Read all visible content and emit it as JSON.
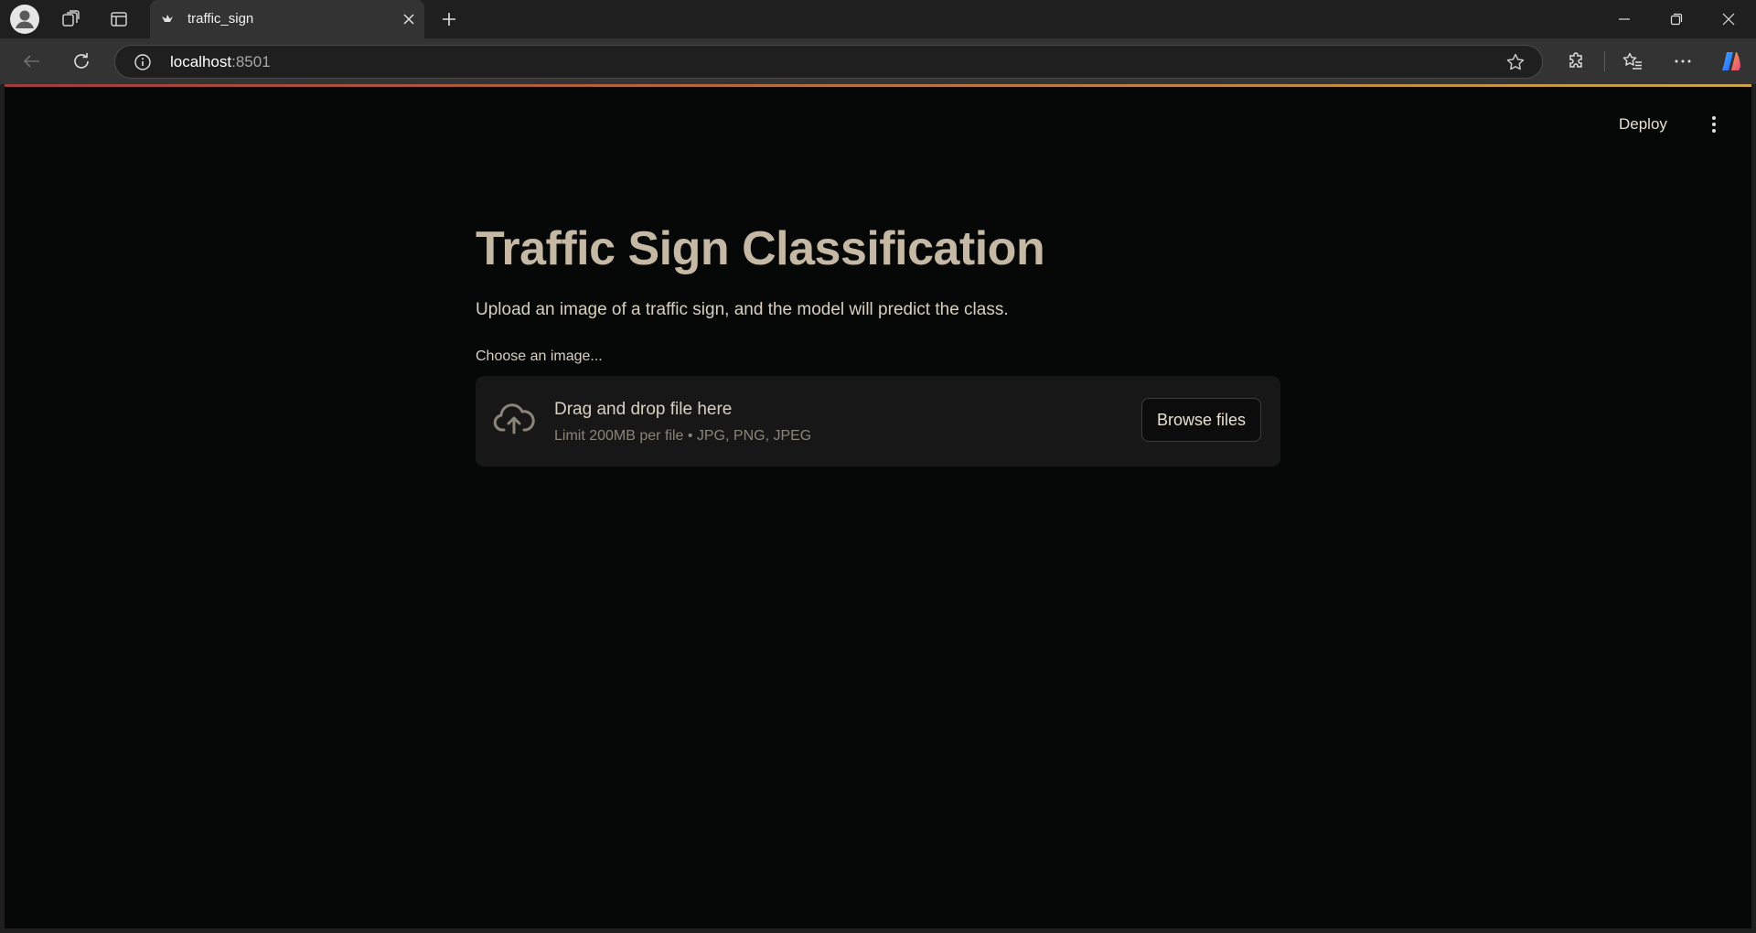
{
  "browser": {
    "tab": {
      "title": "traffic_sign"
    },
    "address": {
      "host": "localhost",
      "port": ":8501"
    }
  },
  "header": {
    "deploy_label": "Deploy"
  },
  "main": {
    "title": "Traffic Sign Classification",
    "subtitle": "Upload an image of a traffic sign, and the model will predict the class.",
    "uploader": {
      "label": "Choose an image...",
      "drop_text": "Drag and drop file here",
      "limit_text": "Limit 200MB per file • JPG, PNG, JPEG",
      "browse_label": "Browse files"
    }
  },
  "colors": {
    "background": "#060808",
    "title": "#c5b8a4",
    "text": "#d8cfc0",
    "dropzone": "#171717",
    "accent_gradient": [
      "#a33a3a",
      "#c9a24e"
    ]
  },
  "icons": [
    "profile-icon",
    "workspaces-icon",
    "tab-actions-icon",
    "streamlit-favicon",
    "close-icon",
    "plus-icon",
    "minimize-icon",
    "restore-icon",
    "back-icon",
    "refresh-icon",
    "info-icon",
    "star-icon",
    "extensions-icon",
    "favorites-icon",
    "more-icon",
    "copilot-icon",
    "kebab-menu-icon",
    "cloud-upload-icon"
  ]
}
